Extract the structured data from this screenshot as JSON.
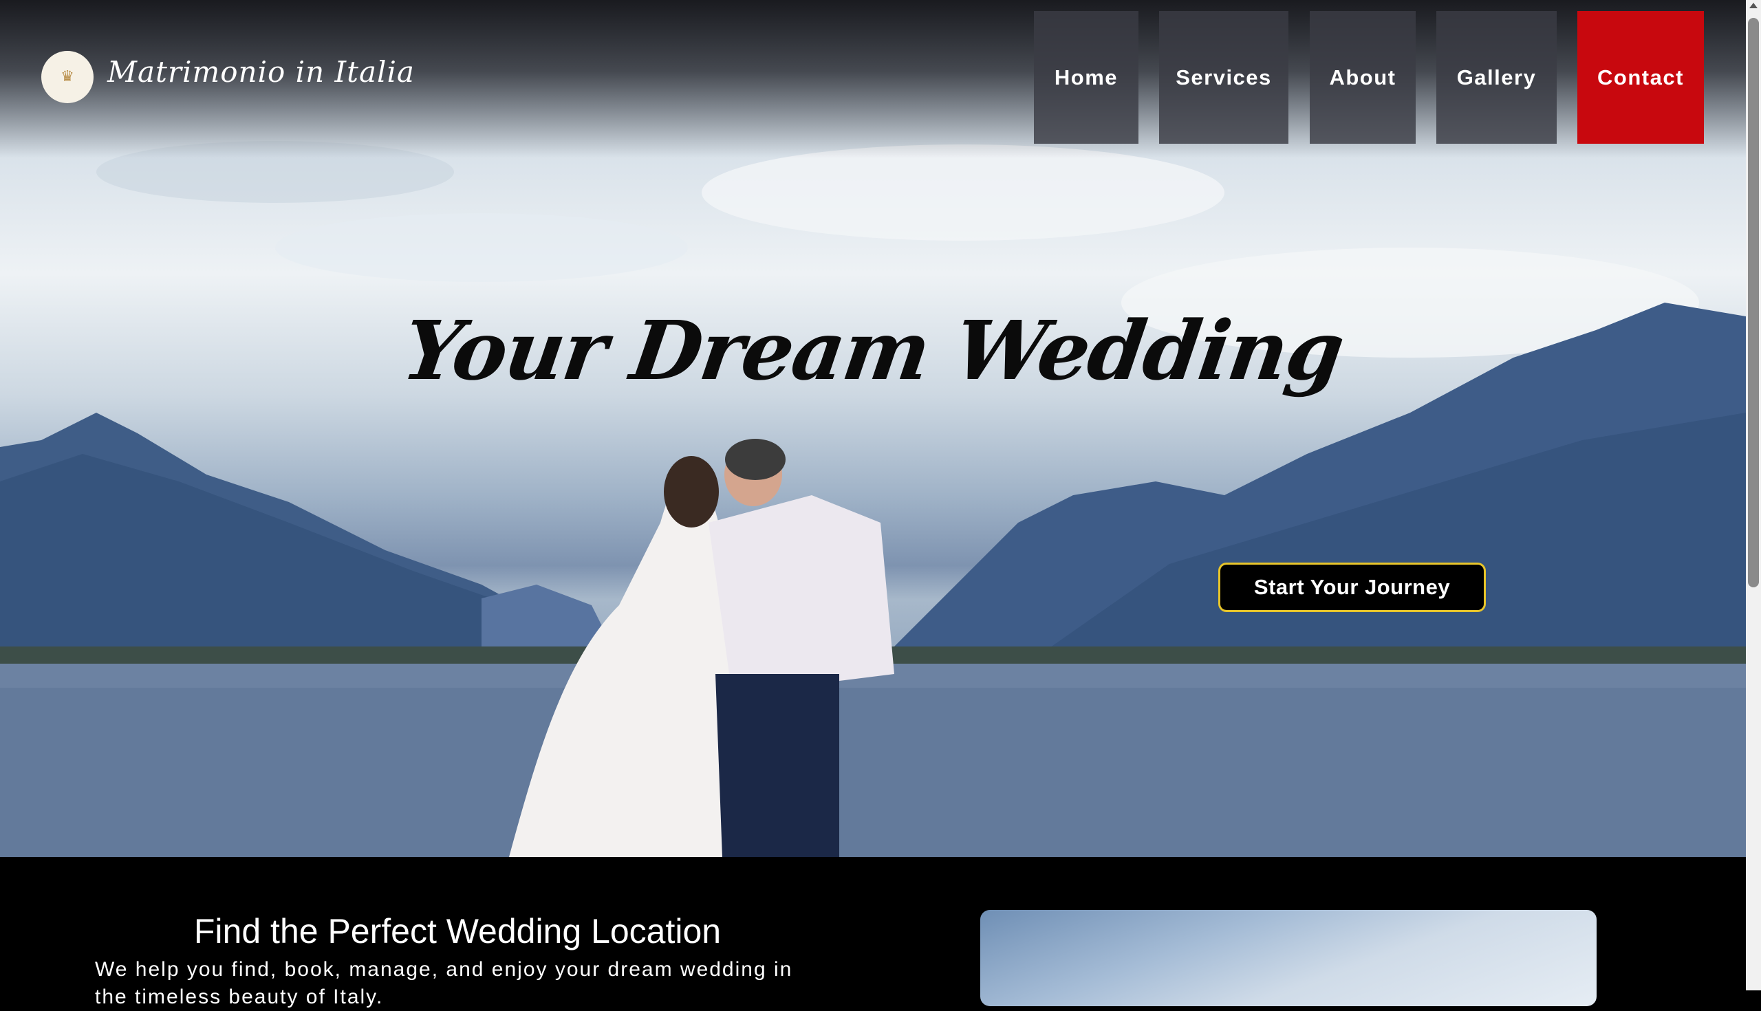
{
  "header": {
    "brand": "Matrimonio in Italia",
    "nav": [
      {
        "label": "Home"
      },
      {
        "label": "Services"
      },
      {
        "label": "About"
      },
      {
        "label": "Gallery"
      },
      {
        "label": "Contact"
      }
    ]
  },
  "hero": {
    "title": "Your Dream Wedding",
    "cta": "Start Your Journey"
  },
  "section": {
    "title": "Find the Perfect Wedding Location",
    "text": "We help you find, book, manage, and enjoy your dream wedding in the timeless beauty of Italy."
  },
  "colors": {
    "contact_bg": "#c8080e",
    "cta_border": "#e8c52a"
  }
}
